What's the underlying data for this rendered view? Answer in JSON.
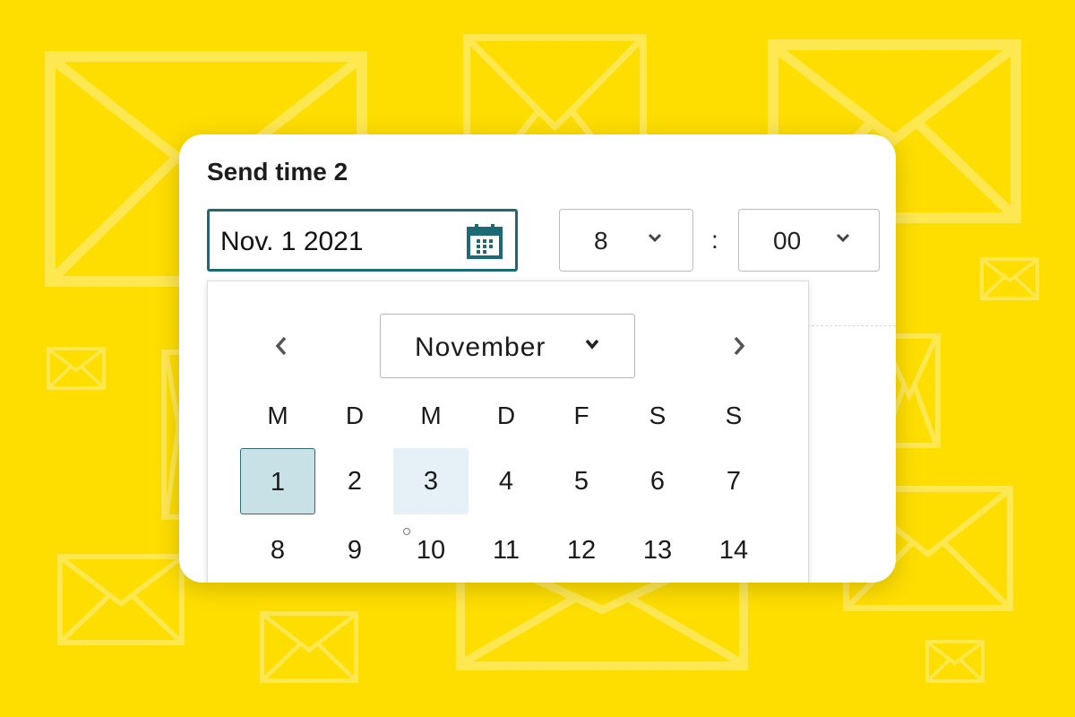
{
  "colors": {
    "background": "#FEDE00",
    "accent": "#1c6a75",
    "selected_day_bg": "#c7e1e6",
    "hover_day_bg": "#e6f1f7"
  },
  "card": {
    "title": "Send time 2",
    "date_input": {
      "value": "Nov. 1 2021",
      "icon": "calendar-icon"
    },
    "hour_select": {
      "value": "8",
      "icon": "chevron-down-icon"
    },
    "separator": ":",
    "minute_select": {
      "value": "00",
      "icon": "chevron-down-icon"
    }
  },
  "datepicker": {
    "prev_icon": "chevron-left-icon",
    "next_icon": "chevron-right-icon",
    "month_select": {
      "value": "November",
      "icon": "chevron-down-icon"
    },
    "weekdays": [
      "M",
      "D",
      "M",
      "D",
      "F",
      "S",
      "S"
    ],
    "weeks": [
      [
        "1",
        "2",
        "3",
        "4",
        "5",
        "6",
        "7"
      ],
      [
        "8",
        "9",
        "10",
        "11",
        "12",
        "13",
        "14"
      ]
    ],
    "selected_day": "1",
    "hovered_day": "3"
  }
}
